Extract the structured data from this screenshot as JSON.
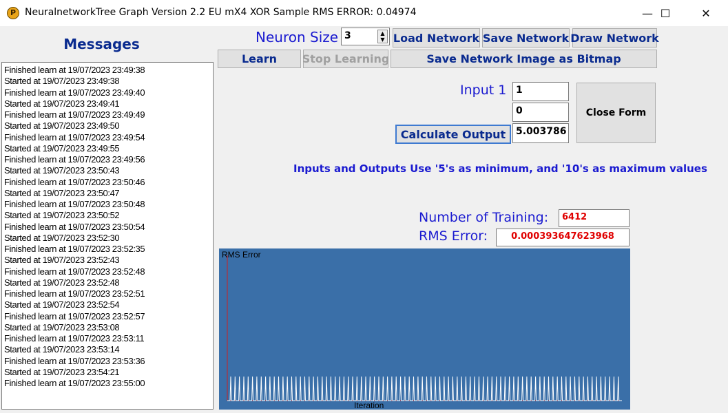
{
  "window": {
    "title": "NeuralnetworkTree Graph Version 2.2 EU mX4 XOR Sample RMS ERROR:   0.04974",
    "icon_letter": "P",
    "minimize_glyph": "—",
    "maximize_glyph": "☐",
    "close_glyph": "✕"
  },
  "messages": {
    "title": "Messages",
    "items": [
      "Finished learn at 19/07/2023 23:49:38",
      "Started at 19/07/2023 23:49:38",
      "Finished learn at 19/07/2023 23:49:40",
      "Started at 19/07/2023 23:49:41",
      "Finished learn at 19/07/2023 23:49:49",
      "Started at 19/07/2023 23:49:50",
      "Finished learn at 19/07/2023 23:49:54",
      "Started at 19/07/2023 23:49:55",
      "Finished learn at 19/07/2023 23:49:56",
      "Started at 19/07/2023 23:50:43",
      "Finished learn at 19/07/2023 23:50:46",
      "Started at 19/07/2023 23:50:47",
      "Finished learn at 19/07/2023 23:50:48",
      "Started at 19/07/2023 23:50:52",
      "Finished learn at 19/07/2023 23:50:54",
      "Started at 19/07/2023 23:52:30",
      "Finished learn at 19/07/2023 23:52:35",
      "Started at 19/07/2023 23:52:43",
      "Finished learn at 19/07/2023 23:52:48",
      "Started at 19/07/2023 23:52:48",
      "Finished learn at 19/07/2023 23:52:51",
      "Started at 19/07/2023 23:52:54",
      "Finished learn at 19/07/2023 23:52:57",
      "Started at 19/07/2023 23:53:08",
      "Finished learn at 19/07/2023 23:53:11",
      "Started at 19/07/2023 23:53:14",
      "Finished learn at 19/07/2023 23:53:36",
      "Started at 19/07/2023 23:54:21",
      "Finished learn at 19/07/2023 23:55:00"
    ]
  },
  "toolbar": {
    "neuron_size_label": "Neuron Size",
    "neuron_size_value": "3",
    "load_network": "Load Network",
    "save_network": "Save Network",
    "draw_network": "Draw Network",
    "learn": "Learn",
    "stop_learning": "Stop Learning",
    "save_bitmap": "Save Network Image as Bitmap"
  },
  "io": {
    "input_label": "Input 1",
    "input1_value": "1",
    "input2_value": "0",
    "calculate_output": "Calculate Output",
    "output_value": "5.003786",
    "close_form": "Close Form",
    "hint": "Inputs and Outputs Use '5's as minimum, and '10's as maximum values"
  },
  "stats": {
    "training_label": "Number of Training:",
    "training_value": "6412",
    "rms_label": "RMS Error:",
    "rms_value": "0.000393647623968"
  },
  "colors": {
    "chart_background": "#3a6fa8",
    "chart_line": "#ffffff",
    "chart_axis": "#cc2222",
    "label_blue": "#1a1ad0",
    "value_red": "#e00000"
  },
  "chart_data": {
    "type": "line",
    "ylabel": "RMS Error",
    "xlabel": "Iteration",
    "pattern": "repeating spikes",
    "spike_count": 90
  }
}
